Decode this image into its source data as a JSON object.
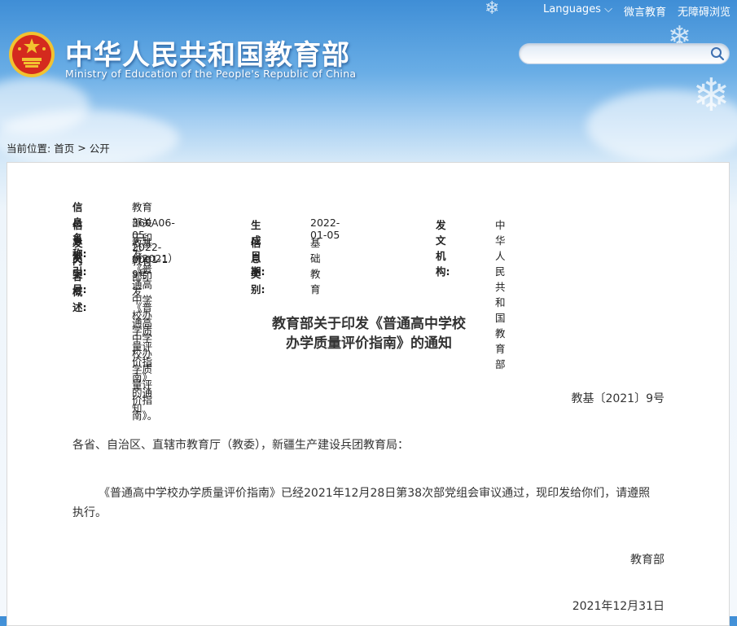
{
  "header": {
    "site_title": "中华人民共和国教育部",
    "site_subtitle": "Ministry of Education of the People's Republic of China",
    "nav": {
      "languages": "Languages",
      "weiyan": "微言教育",
      "accessible": "无障碍浏览"
    },
    "search": {
      "placeholder": ""
    }
  },
  "breadcrumb": {
    "prefix": "当前位置:",
    "home": "首页",
    "separator": ">",
    "current": "公开"
  },
  "metadata": {
    "name_label": "信息名称:",
    "name_value": "教育部关于印发《普通高中学校办学质量评价指南》的通知",
    "index_label": "信息索引:",
    "index_value": "360A06-05-2022-0001-1",
    "date_label": "生成日期:",
    "date_value": "2022-01-05",
    "org_label": "发文机构:",
    "org_value": "中华人民共和国教育部",
    "docno_label": "发文字号:",
    "docno_value": "教基（2021）9号",
    "category_label": "信息类别:",
    "category_value": "基础教育",
    "summary_label": "内容概述:",
    "summary_value": "教育部印发《普通高中学校办学质量评价指南》。"
  },
  "document": {
    "title_line1": "教育部关于印发《普通高中学校",
    "title_line2": "办学质量评价指南》的通知",
    "doc_number": "教基〔2021〕9号",
    "salutation": "各省、自治区、直辖市教育厅（教委），新疆生产建设兵团教育局：",
    "body_line1": "《普通高中学校办学质量评价指南》已经2021年12月28日第38次部党组会审议通过，现印发给你们，请遵照",
    "body_line2": "执行。",
    "signature": "教育部",
    "date": "2021年12月31日"
  },
  "colors": {
    "sky_top": "#3f8ed6",
    "sky_bottom": "#f4f8fc",
    "emblem_red": "#d42a1e",
    "emblem_gold": "#f2c230"
  }
}
